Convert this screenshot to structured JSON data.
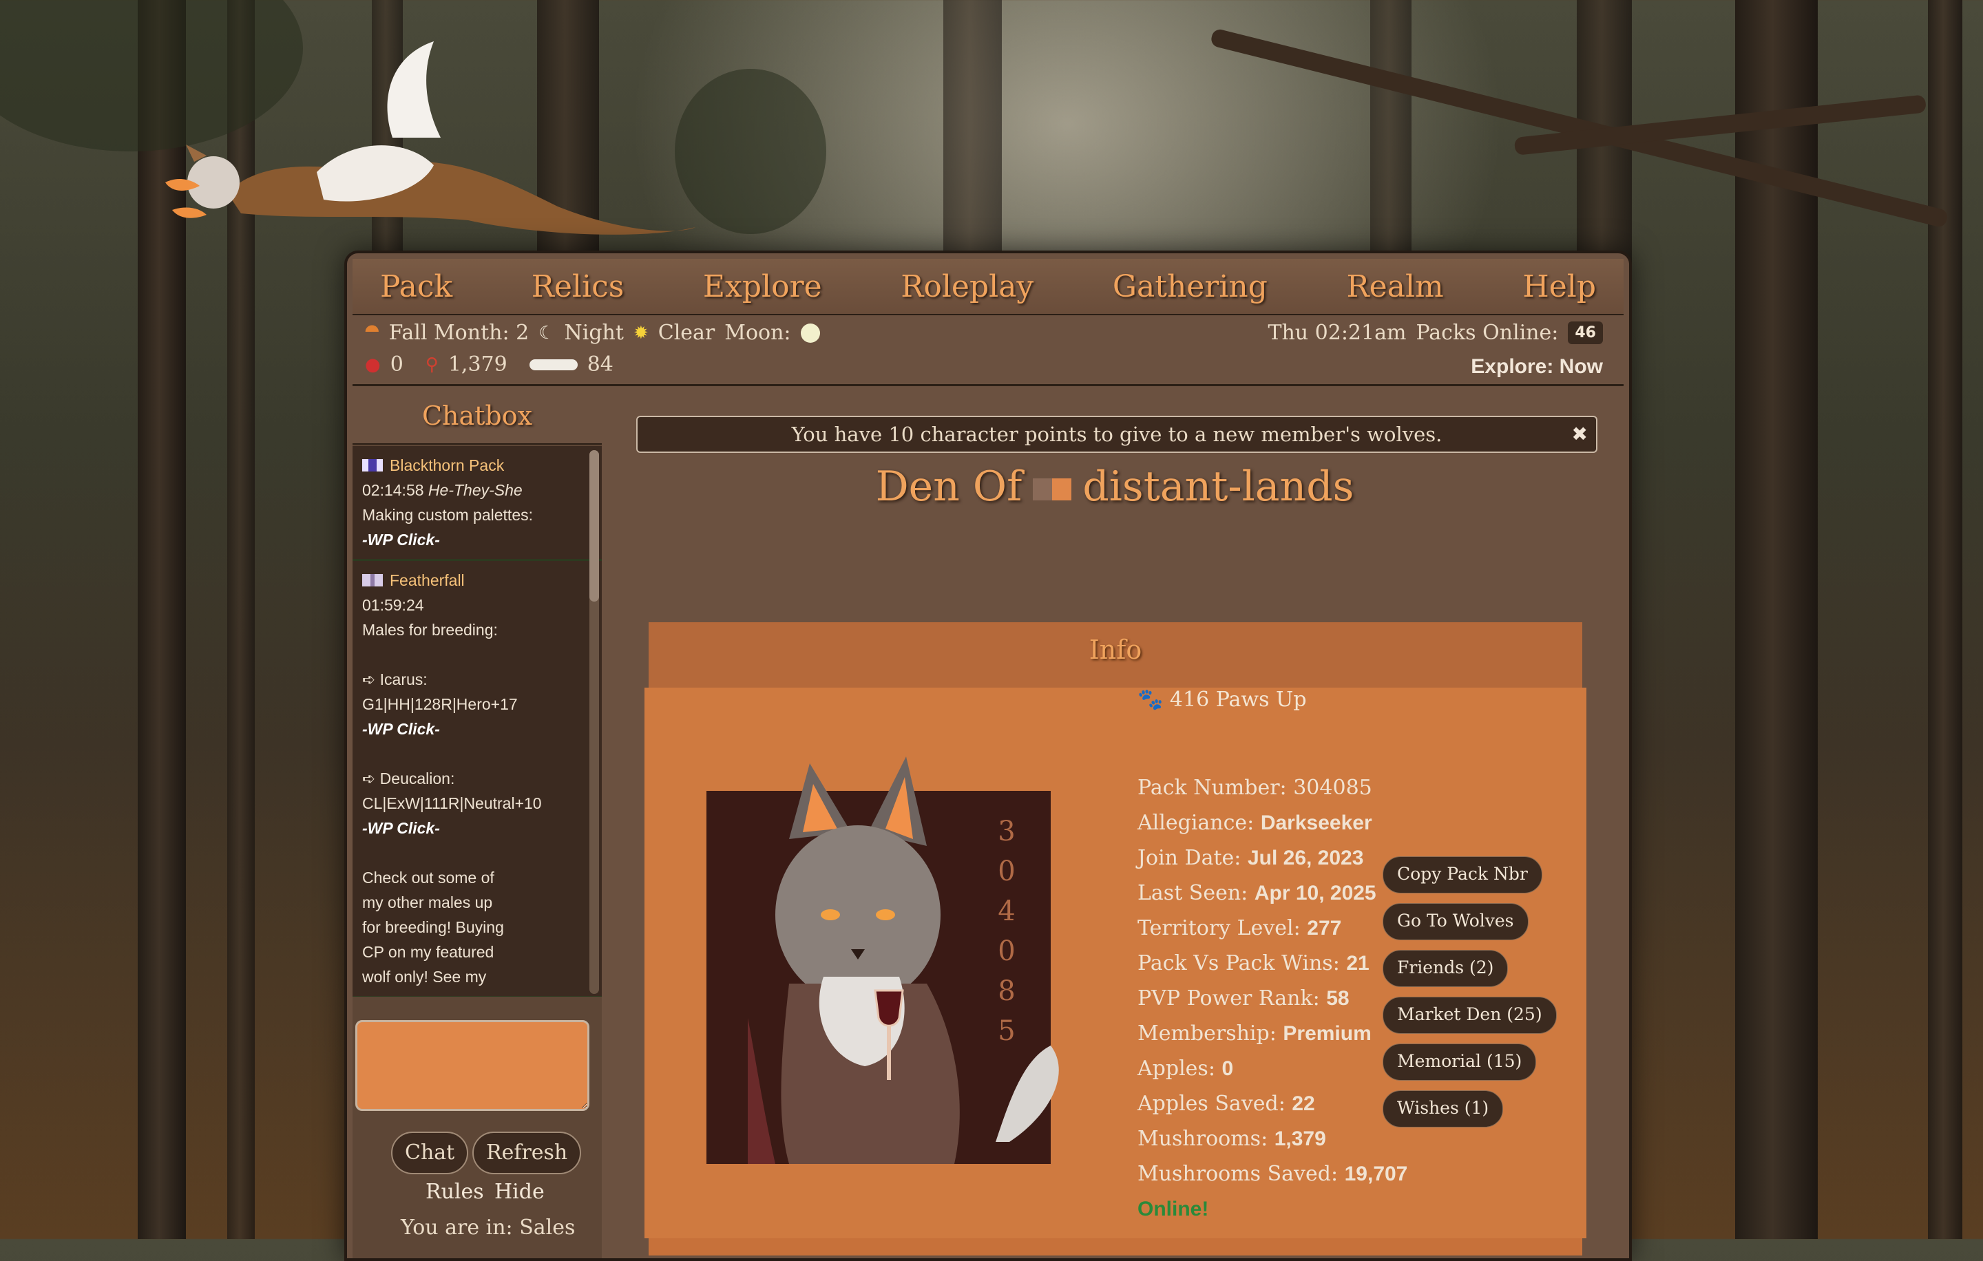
{
  "nav": {
    "items": [
      "Pack",
      "Relics",
      "Explore",
      "Roleplay",
      "Gathering",
      "Realm",
      "Help"
    ]
  },
  "status": {
    "season": "Fall Month: 2",
    "time_of_day": "Night",
    "weather": "Clear",
    "moon_label": "Moon:",
    "datetime": "Thu 02:21am",
    "packs_online_label": "Packs Online:",
    "packs_online": "46",
    "apples": "0",
    "mushrooms": "1,379",
    "bones": "84",
    "explore": "Explore: Now",
    "icons": {
      "season": "leaf-icon",
      "time": "moon-icon",
      "weather": "sun-icon",
      "moon": "full-moon-icon",
      "apple": "apple-icon",
      "mushroom": "mushroom-icon",
      "bone": "bone-icon"
    }
  },
  "chatbox": {
    "title": "Chatbox",
    "entries": [
      {
        "pack": "Blackthorn Pack",
        "time": "02:14:58",
        "user": "He-They-She",
        "lines": [
          "Making custom palettes:"
        ],
        "link": "-WP Click-"
      },
      {
        "pack": "Featherfall",
        "time": "01:59:24",
        "lines": [
          "Males for breeding:",
          "",
          "➪ Icarus:",
          "G1|HH|128R|Hero+17"
        ],
        "link": "-WP Click-",
        "more_lines": [
          "➪ Deucalion:",
          "CL|ExW|111R|Neutral+10"
        ],
        "more_link": "-WP Click-",
        "tail_lines": [
          "Check out some of",
          "my other males up",
          "for breeding! Buying",
          "CP on my featured",
          "wolf only! See my"
        ]
      }
    ],
    "buttons": {
      "chat": "Chat",
      "refresh": "Refresh"
    },
    "links": {
      "rules": "Rules",
      "hide": "Hide"
    },
    "location": "You are in: Sales"
  },
  "notice": {
    "text": "You have 10 character points to give to a new member's wolves.",
    "close": "✖"
  },
  "den": {
    "prefix": "Den Of",
    "name": "distant-lands"
  },
  "info": {
    "title": "Info",
    "paws_up": "416 Paws Up",
    "avatar_number": [
      "3",
      "0",
      "4",
      "0",
      "8",
      "5"
    ],
    "stats": [
      {
        "label": "Pack Number:",
        "value": "304085",
        "bold": false
      },
      {
        "label": "Allegiance:",
        "value": "Darkseeker",
        "bold": true
      },
      {
        "label": "Join Date:",
        "value": "Jul 26, 2023",
        "bold": true
      },
      {
        "label": "Last Seen:",
        "value": "Apr 10, 2025",
        "bold": true
      },
      {
        "label": "Territory Level:",
        "value": "277",
        "bold": true
      },
      {
        "label": "Pack Vs Pack Wins:",
        "value": "21",
        "bold": true
      },
      {
        "label": "PVP Power Rank:",
        "value": "58",
        "bold": true
      },
      {
        "label": "Membership:",
        "value": "Premium",
        "bold": true
      },
      {
        "label": "Apples:",
        "value": "0",
        "bold": true
      },
      {
        "label": "Apples Saved:",
        "value": "22",
        "bold": true
      },
      {
        "label": "Mushrooms:",
        "value": "1,379",
        "bold": true
      },
      {
        "label": "Mushrooms Saved:",
        "value": "19,707",
        "bold": true
      }
    ],
    "online": "Online!",
    "actions": [
      "Copy Pack Nbr",
      "Go To Wolves",
      "Friends  (2)",
      "Market Den  (25)",
      "Memorial  (15)",
      "Wishes  (1)"
    ]
  }
}
